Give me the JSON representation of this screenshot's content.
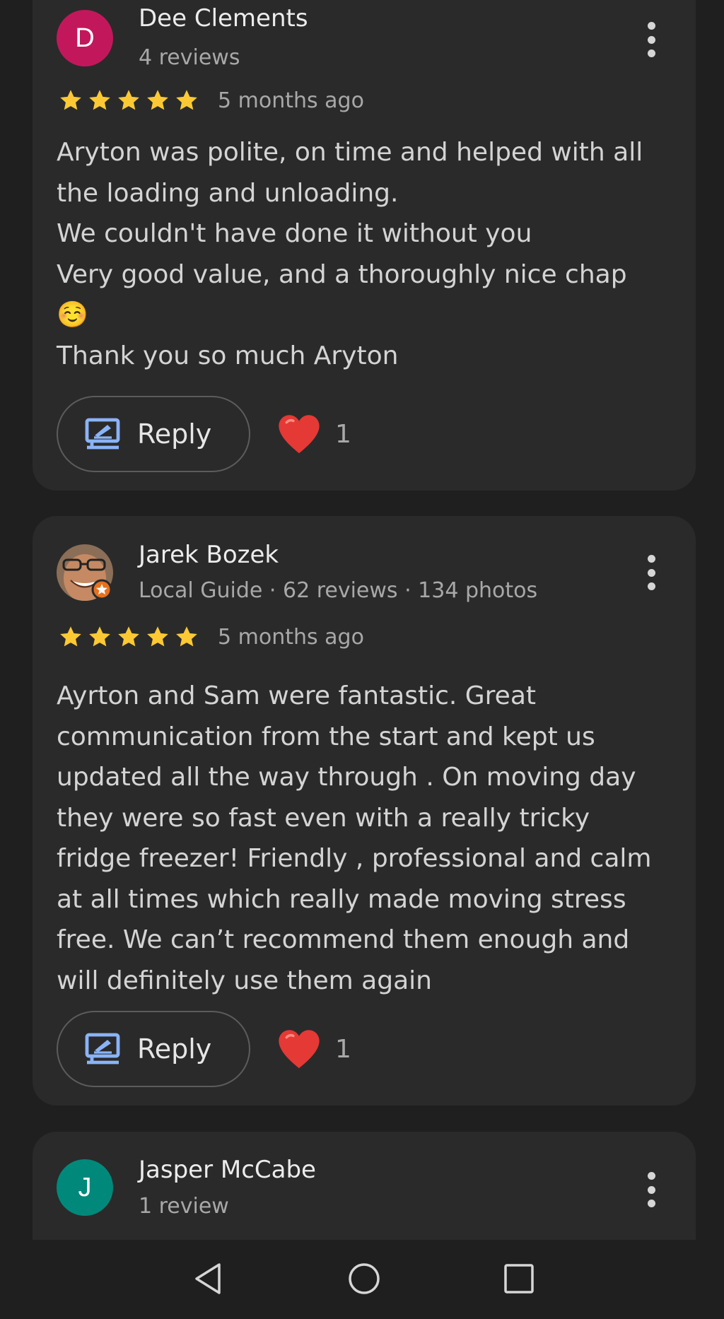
{
  "colors": {
    "background": "#1f1f1f",
    "card": "#2a2a2a",
    "star": "#fcc934",
    "reply_icon": "#8ab4f8",
    "heart": "#e53935"
  },
  "reviews": [
    {
      "author": "Dee Clements",
      "avatar_letter": "D",
      "avatar_color": "#c2185b",
      "meta": "4 reviews",
      "stars": 5,
      "date": "5 months ago",
      "text": "Aryton was polite, on time and helped with all\nthe loading and unloading.\nWe couldn't have done it without you\nVery good value, and a thoroughly nice chap\n☺️\nThank you so much Aryton",
      "reply_label": "Reply",
      "likes": "1"
    },
    {
      "author": "Jarek Bozek",
      "avatar_letter": "",
      "avatar_color": "#7a5a44",
      "meta": "Local Guide · 62 reviews · 134 photos",
      "stars": 5,
      "date": "5 months ago",
      "text": "Ayrton and Sam were fantastic. Great\ncommunication from the start and kept us\nupdated all the way through . On moving day\nthey were so fast even with a really tricky\nfridge freezer! Friendly , professional and calm\nat all times which really made moving stress\nfree. We can’t recommend them enough and\nwill definitely use them again",
      "reply_label": "Reply",
      "likes": "1"
    },
    {
      "author": "Jasper McCabe",
      "avatar_letter": "J",
      "avatar_color": "#00897b",
      "meta": "1 review"
    }
  ],
  "navbar": {
    "back": "back-icon",
    "home": "home-icon",
    "recents": "recents-icon"
  }
}
